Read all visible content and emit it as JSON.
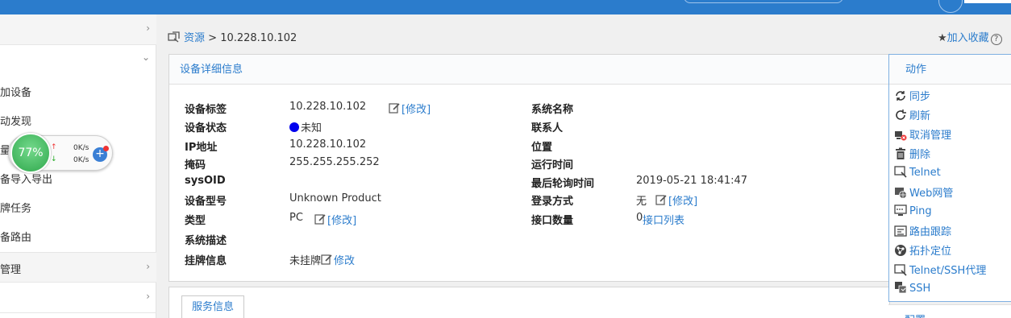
{
  "breadcrumb": {
    "root": "资源",
    "sep": " > ",
    "current": "10.228.10.102"
  },
  "favorites": {
    "label": "加入收藏",
    "help": "?"
  },
  "sidebar": {
    "items": [
      {
        "label": "",
        "chevron": "›"
      },
      {
        "label": "",
        "chevron": "⌄"
      },
      {
        "label": "加设备"
      },
      {
        "label": "动发现"
      },
      {
        "label": "量"
      },
      {
        "label": "备导入导出"
      },
      {
        "label": "牌任务"
      },
      {
        "label": "备路由"
      },
      {
        "label": "管理",
        "chevron": "›"
      },
      {
        "label": "",
        "chevron": "›"
      }
    ]
  },
  "speed_widget": {
    "percent": "77%",
    "upload": "0K/s",
    "download": "0K/s",
    "plus": "+"
  },
  "detail": {
    "title": "设备详细信息",
    "left": [
      {
        "key": "设备标签",
        "value": "10.228.10.102",
        "edit": "[修改]"
      },
      {
        "key": "设备状态",
        "value": "未知"
      },
      {
        "key": "IP地址",
        "value": "10.228.10.102"
      },
      {
        "key": "掩码",
        "value": "255.255.255.252"
      },
      {
        "key": "sysOID",
        "value": ""
      },
      {
        "key": "设备型号",
        "value": "Unknown Product"
      },
      {
        "key": "类型",
        "value": "PC",
        "edit": "[修改]"
      },
      {
        "key": "系统描述",
        "value": ""
      },
      {
        "key": "挂牌信息",
        "value": "未挂牌",
        "edit": "修改"
      }
    ],
    "right": [
      {
        "key": "系统名称",
        "value": ""
      },
      {
        "key": "联系人",
        "value": ""
      },
      {
        "key": "位置",
        "value": ""
      },
      {
        "key": "运行时间",
        "value": ""
      },
      {
        "key": "最后轮询时间",
        "value": "2019-05-21 18:41:47"
      },
      {
        "key": "登录方式",
        "value": "无",
        "edit": "[修改]"
      },
      {
        "key": "接口数量",
        "value": "0",
        "link": "接口列表"
      }
    ]
  },
  "service": {
    "tab": "服务信息"
  },
  "actions": {
    "title": "动作",
    "items": [
      {
        "label": "同步",
        "icon": "sync-icon"
      },
      {
        "label": "刷新",
        "icon": "refresh-icon"
      },
      {
        "label": "取消管理",
        "icon": "unmanage-icon"
      },
      {
        "label": "删除",
        "icon": "trash-icon"
      },
      {
        "label": "Telnet",
        "icon": "telnet-icon"
      },
      {
        "label": "Web网管",
        "icon": "web-manage-icon"
      },
      {
        "label": "Ping",
        "icon": "ping-icon"
      },
      {
        "label": "路由跟踪",
        "icon": "traceroute-icon"
      },
      {
        "label": "拓扑定位",
        "icon": "topology-locate-icon"
      },
      {
        "label": "Telnet/SSH代理",
        "icon": "telnet-ssh-proxy-icon"
      },
      {
        "label": "SSH",
        "icon": "ssh-icon"
      }
    ],
    "config_title": "配置"
  }
}
